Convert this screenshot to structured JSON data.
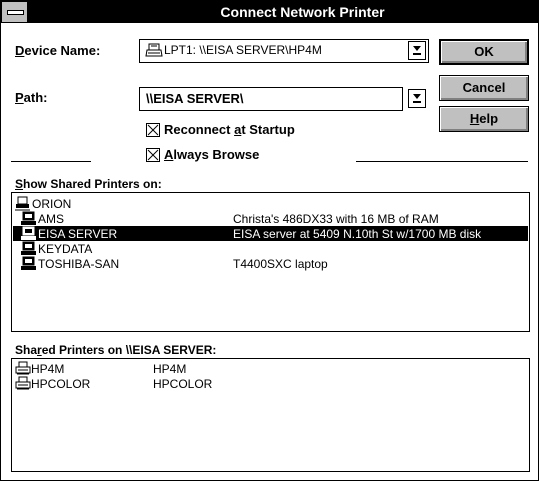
{
  "window": {
    "title": "Connect Network Printer"
  },
  "device": {
    "label_pre": "",
    "label_key": "D",
    "label_post": "evice Name:",
    "value": "LPT1:  \\\\EISA SERVER\\HP4M",
    "icon": "printer-icon"
  },
  "path": {
    "label_key": "P",
    "label_post": "ath:",
    "value": "\\\\EISA SERVER\\"
  },
  "buttons": {
    "ok": "OK",
    "cancel": "Cancel",
    "help_key": "H",
    "help_post": "elp"
  },
  "options": {
    "reconnect_pre": "Reconnect ",
    "reconnect_key": "a",
    "reconnect_post": "t Startup",
    "reconnect_checked": true,
    "browse_key": "A",
    "browse_post": "lways Browse",
    "browse_checked": true
  },
  "shared_printers_on": {
    "label_key": "S",
    "label_post": "how Shared Printers on:",
    "items": [
      {
        "name": "ORION",
        "desc": "",
        "icon": "network-icon",
        "selected": false,
        "indent": 0
      },
      {
        "name": "AMS",
        "desc": "Christa's 486DX33 with 16 MB of RAM",
        "icon": "computer-icon",
        "selected": false,
        "indent": 1
      },
      {
        "name": "EISA SERVER",
        "desc": "EISA server at 5409 N.10th St w/1700 MB disk",
        "icon": "computer-icon",
        "selected": true,
        "indent": 1
      },
      {
        "name": "KEYDATA",
        "desc": "",
        "icon": "computer-icon",
        "selected": false,
        "indent": 1
      },
      {
        "name": "TOSHIBA-SAN",
        "desc": "T4400SXC laptop",
        "icon": "computer-icon",
        "selected": false,
        "indent": 1
      }
    ]
  },
  "shared_printers": {
    "label_pre": "Sha",
    "label_key": "r",
    "label_post": "ed Printers on \\\\EISA SERVER:",
    "items": [
      {
        "name": "HP4M",
        "desc": "HP4M",
        "icon": "printer-icon"
      },
      {
        "name": "HPCOLOR",
        "desc": "HPCOLOR",
        "icon": "printer-icon"
      }
    ]
  }
}
